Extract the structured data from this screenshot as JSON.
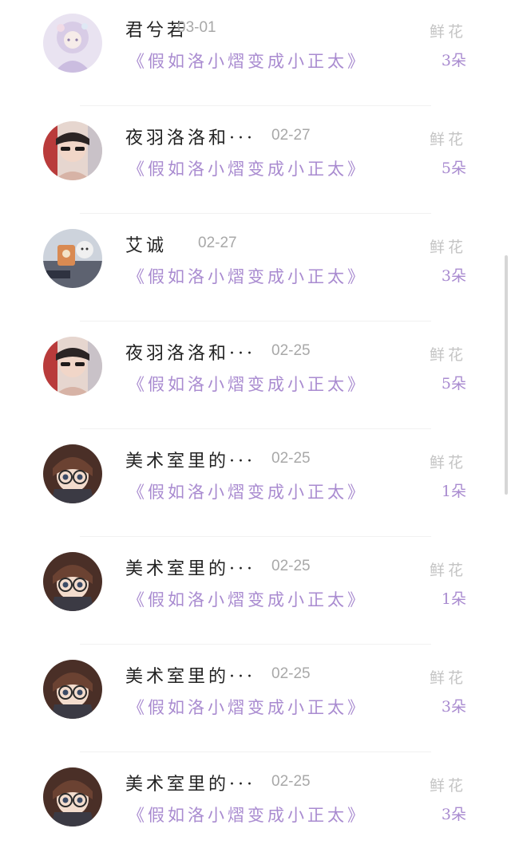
{
  "gift_label": "鲜花",
  "book_title": "《假如洛小熠变成小正太》",
  "records": [
    {
      "name": "君兮若",
      "date": "03-01",
      "count": "3朵"
    },
    {
      "name": "夜羽洛洛和···",
      "date": "02-27",
      "count": "5朵"
    },
    {
      "name": "艾诚",
      "date": "02-27",
      "count": "3朵"
    },
    {
      "name": "夜羽洛洛和···",
      "date": "02-25",
      "count": "5朵"
    },
    {
      "name": "美术室里的···",
      "date": "02-25",
      "count": "1朵"
    },
    {
      "name": "美术室里的···",
      "date": "02-25",
      "count": "1朵"
    },
    {
      "name": "美术室里的···",
      "date": "02-25",
      "count": "3朵"
    },
    {
      "name": "美术室里的···",
      "date": "02-25",
      "count": "3朵"
    }
  ]
}
